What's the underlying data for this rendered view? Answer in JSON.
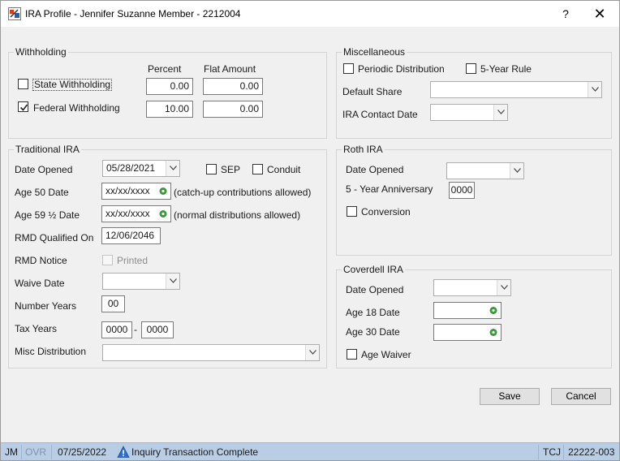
{
  "window": {
    "title": "IRA Profile - Jennifer Suzanne Member - 2212004",
    "help_label": "?",
    "close_label": "✕"
  },
  "withholding": {
    "legend": "Withholding",
    "percent_header": "Percent",
    "flat_header": "Flat Amount",
    "state_label": "State Withholding",
    "state_checked": false,
    "state_percent": "0.00",
    "state_flat": "0.00",
    "federal_label": "Federal Withholding",
    "federal_checked": true,
    "federal_percent": "10.00",
    "federal_flat": "0.00"
  },
  "misc": {
    "legend": "Miscellaneous",
    "periodic_label": "Periodic Distribution",
    "five_year_label": "5-Year Rule",
    "default_share_label": "Default Share",
    "default_share_value": "",
    "contact_date_label": "IRA Contact Date",
    "contact_date_value": ""
  },
  "traditional": {
    "legend": "Traditional IRA",
    "date_opened_label": "Date Opened",
    "date_opened_value": "05/28/2021",
    "sep_label": "SEP",
    "conduit_label": "Conduit",
    "age50_label": "Age 50 Date",
    "age50_value": "xx/xx/xxxx",
    "age50_note": "(catch-up contributions allowed)",
    "age59_label": "Age 59 ½ Date",
    "age59_value": "xx/xx/xxxx",
    "age59_note": "(normal distributions allowed)",
    "rmd_qualified_label": "RMD Qualified On",
    "rmd_qualified_value": "12/06/2046",
    "rmd_notice_label": "RMD Notice",
    "printed_label": "Printed",
    "waive_date_label": "Waive Date",
    "waive_date_value": "",
    "number_years_label": "Number Years",
    "number_years_value": "00",
    "tax_years_label": "Tax Years",
    "tax_year_from": "0000",
    "tax_year_sep": "-",
    "tax_year_to": "0000",
    "misc_dist_label": "Misc Distribution",
    "misc_dist_value": ""
  },
  "roth": {
    "legend": "Roth IRA",
    "date_opened_label": "Date Opened",
    "date_opened_value": "",
    "anniversary_label": "5 - Year Anniversary",
    "anniversary_value": "0000",
    "conversion_label": "Conversion"
  },
  "coverdell": {
    "legend": "Coverdell IRA",
    "date_opened_label": "Date Opened",
    "date_opened_value": "",
    "age18_label": "Age 18 Date",
    "age18_value": "",
    "age30_label": "Age 30 Date",
    "age30_value": "",
    "age_waiver_label": "Age Waiver"
  },
  "buttons": {
    "save": "Save",
    "cancel": "Cancel"
  },
  "status": {
    "user": "JM",
    "ovr": "OVR",
    "date": "07/25/2022",
    "message": "Inquiry Transaction Complete",
    "code": "TCJ",
    "session": "22222-003"
  },
  "colors": {
    "status_bar": "#b9cde5",
    "eye_icon": "#3a9a3a",
    "warning_icon": "#2f6fd0"
  }
}
